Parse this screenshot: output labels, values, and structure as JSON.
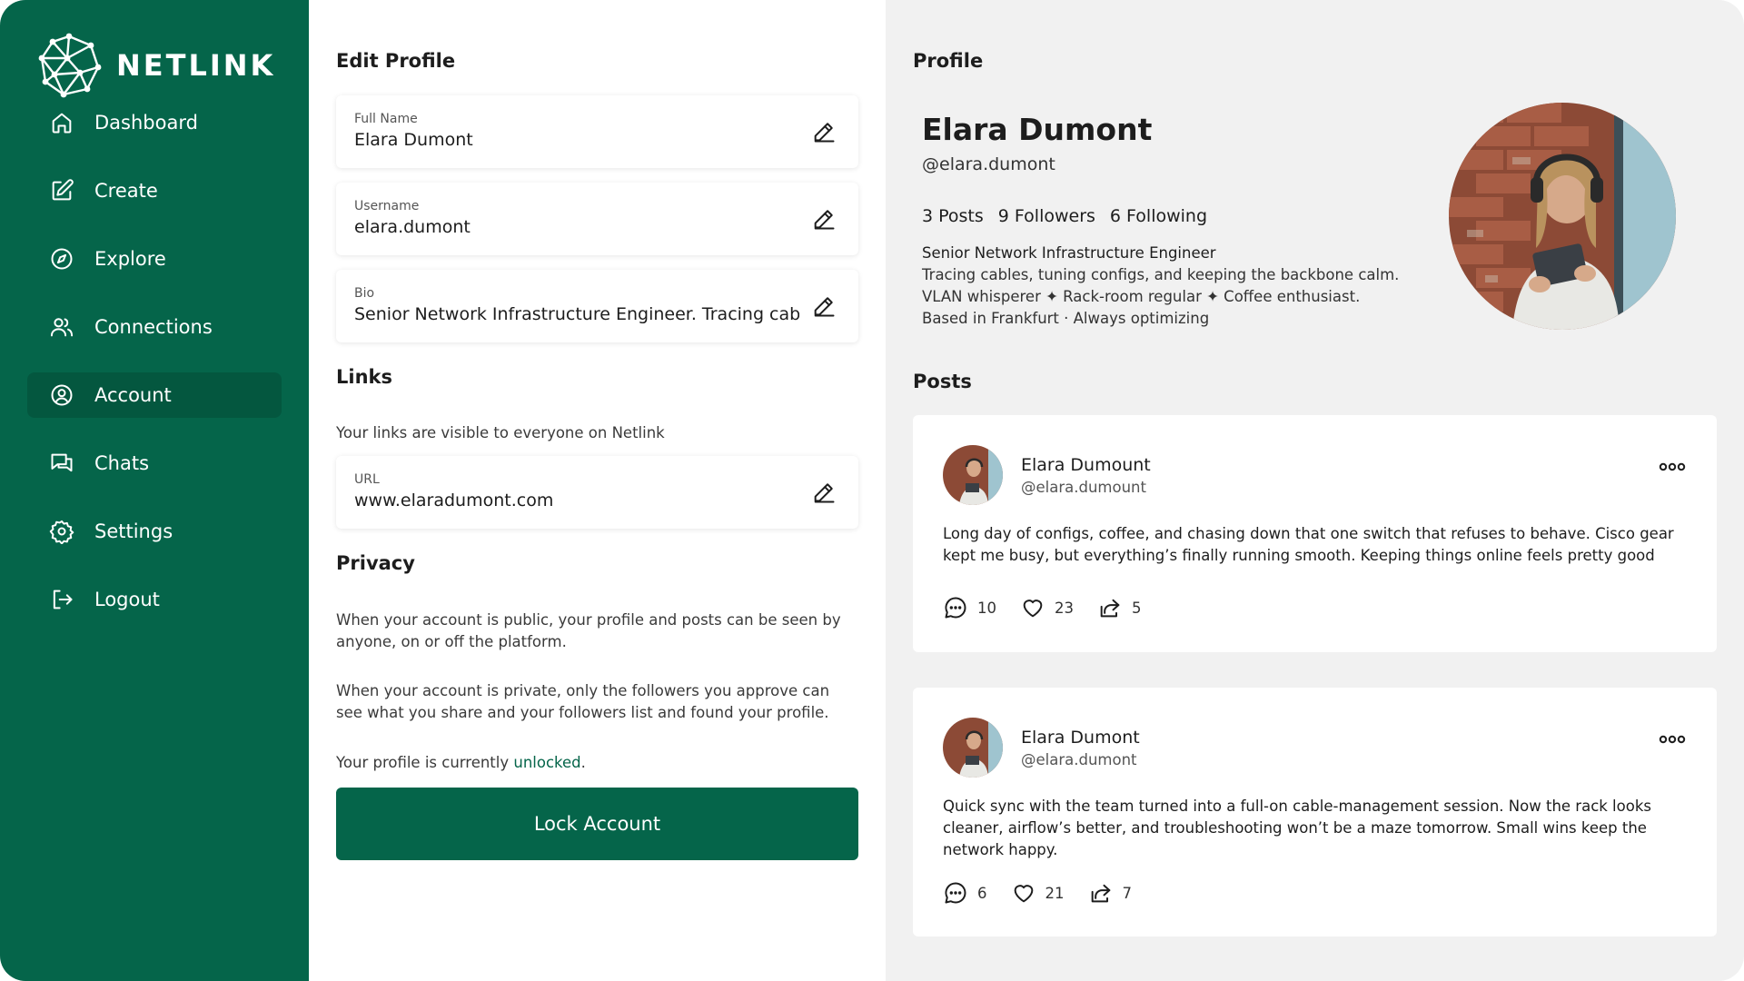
{
  "brand": {
    "name": "NETLINK"
  },
  "nav": [
    {
      "label": "Dashboard",
      "icon": "home-icon"
    },
    {
      "label": "Create",
      "icon": "edit-square-icon"
    },
    {
      "label": "Explore",
      "icon": "compass-icon"
    },
    {
      "label": "Connections",
      "icon": "users-icon"
    },
    {
      "label": "Account",
      "icon": "user-circle-icon",
      "active": true
    },
    {
      "label": "Chats",
      "icon": "chat-icon"
    },
    {
      "label": "Settings",
      "icon": "gear-icon"
    },
    {
      "label": "Logout",
      "icon": "logout-icon"
    }
  ],
  "edit": {
    "title": "Edit Profile",
    "full_name": {
      "label": "Full Name",
      "value": "Elara Dumont"
    },
    "username": {
      "label": "Username",
      "value": "elara.dumont"
    },
    "bio": {
      "label": "Bio",
      "value": "Senior Network Infrastructure Engineer. Tracing cab"
    },
    "links_title": "Links",
    "links_note": "Your links are visible to everyone on Netlink",
    "url": {
      "label": "URL",
      "value": "www.elaradumont.com"
    },
    "privacy_title": "Privacy",
    "privacy_public": "When your account is public, your profile and posts can be seen by anyone, on or off the platform.",
    "privacy_private": "When your account is private, only the followers you approve can see what you share and your followers list and found your profile.",
    "status_prefix": "Your profile is currently ",
    "status_value": "unlocked",
    "status_suffix": ".",
    "lock_button": "Lock Account"
  },
  "profile": {
    "title": "Profile",
    "name": "Elara Dumont",
    "handle": "@elara.dumont",
    "posts_count": "3 Posts",
    "followers_count": "9 Followers",
    "following_count": "6 Following",
    "bio_lines": [
      "Senior Network Infrastructure Engineer",
      "Tracing cables, tuning configs, and keeping the backbone calm.",
      "VLAN whisperer ✦ Rack-room regular ✦ Coffee enthusiast.",
      "Based in Frankfurt · Always optimizing"
    ]
  },
  "posts": {
    "title": "Posts",
    "items": [
      {
        "name": "Elara Dumount",
        "handle": "@elara.dumount",
        "text": "Long day of configs, coffee, and chasing down that one switch that refuses to behave. Cisco gear kept me busy, but everything’s finally running smooth. Keeping things online feels pretty good",
        "comments": "10",
        "likes": "23",
        "shares": "5"
      },
      {
        "name": "Elara Dumont",
        "handle": "@elara.dumont",
        "text": "Quick sync with the team turned into a full-on cable-management session. Now the rack looks cleaner, airflow’s better, and troubleshooting won’t be a maze tomorrow. Small wins keep the network happy.",
        "comments": "6",
        "likes": "21",
        "shares": "7"
      }
    ]
  },
  "colors": {
    "brand_green": "#05654a",
    "panel_gray": "#f1f1f1"
  }
}
